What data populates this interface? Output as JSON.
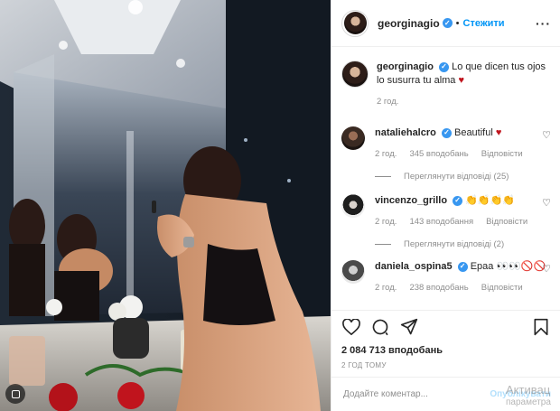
{
  "post": {
    "username": "georginagio",
    "follow_label": "Стежити",
    "more_icon": "ellipsis-icon",
    "caption_name": "georginagio",
    "caption_text": "Lo que dicen tus ojos lo susurra tu alma",
    "caption_time": "2 год."
  },
  "comments": [
    {
      "name": "nataliehalcro",
      "text": "Beautiful",
      "time": "2 год.",
      "likes": "345 вподобань",
      "reply": "Відповісти",
      "view_replies": "Переглянути відповіді (25)"
    },
    {
      "name": "vincenzo_grillo",
      "text": "👏👏👏👏",
      "time": "2 год.",
      "likes": "143 вподобання",
      "reply": "Відповісти",
      "view_replies": "Переглянути відповіді (2)"
    },
    {
      "name": "daniela_ospina5",
      "text": "Epaa 👀👀🚫🚫",
      "time": "2 год.",
      "likes": "238 вподобань",
      "reply": "Відповісти"
    }
  ],
  "stats": {
    "likes": "2 084 713 вподобань",
    "time": "2 год тому"
  },
  "add_comment": {
    "placeholder": "Додайте коментар...",
    "post_label": "Опублікувати"
  },
  "watermark": {
    "line1": "Активац",
    "line2": "параметра"
  },
  "colors": {
    "accent": "#0095f6",
    "verified": "#3897f0",
    "meta": "#8e8e8e"
  }
}
